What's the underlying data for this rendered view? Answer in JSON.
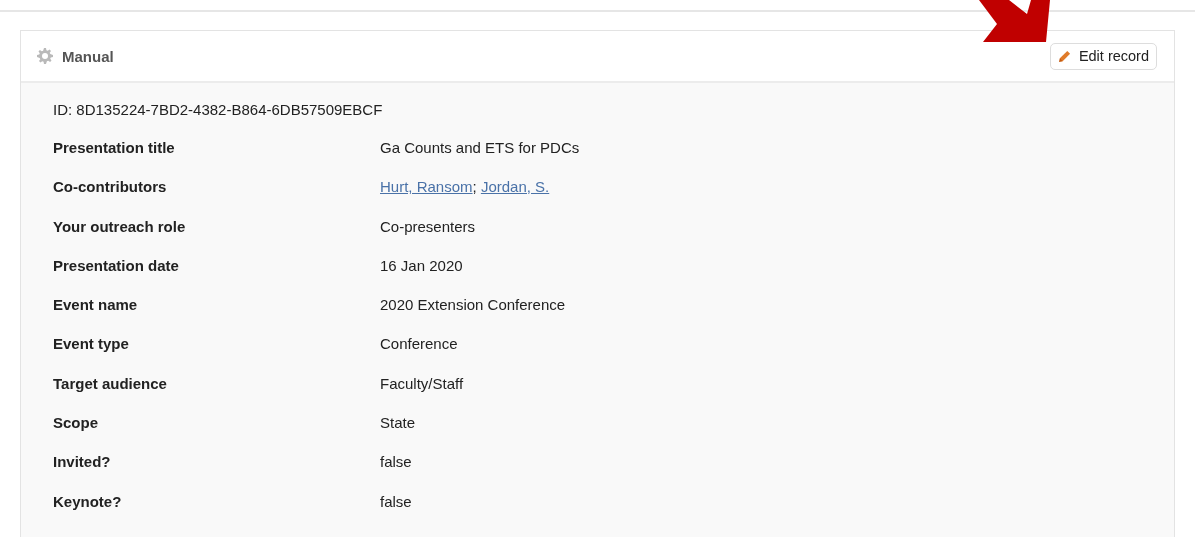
{
  "card": {
    "title": "Manual",
    "edit_button": "Edit record",
    "id_text": "ID: 8D135224-7BD2-4382-B864-6DB57509EBCF"
  },
  "fields": [
    {
      "label": "Presentation title",
      "kind": "text",
      "value": "Ga Counts and ETS for PDCs"
    },
    {
      "label": "Co-contributors",
      "kind": "links",
      "links": [
        "Hurt, Ransom",
        "Jordan, S."
      ],
      "separator": ";"
    },
    {
      "label": "Your outreach role",
      "kind": "text",
      "value": "Co-presenters"
    },
    {
      "label": "Presentation date",
      "kind": "text",
      "value": "16 Jan 2020"
    },
    {
      "label": "Event name",
      "kind": "text",
      "value": "2020 Extension Conference"
    },
    {
      "label": "Event type",
      "kind": "text",
      "value": "Conference"
    },
    {
      "label": "Target audience",
      "kind": "text",
      "value": "Faculty/Staff"
    },
    {
      "label": "Scope",
      "kind": "text",
      "value": "State"
    },
    {
      "label": "Invited?",
      "kind": "text",
      "value": "false"
    },
    {
      "label": "Keynote?",
      "kind": "text",
      "value": "false"
    }
  ]
}
